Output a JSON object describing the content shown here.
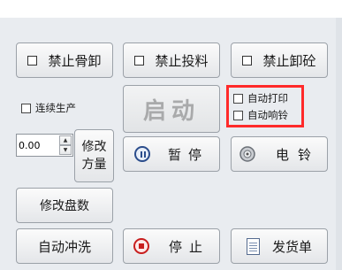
{
  "top_buttons": {
    "forbid_bone_unload": "禁止骨卸",
    "forbid_feed": "禁止投料",
    "forbid_concrete_unload": "禁止卸砼"
  },
  "continuous_production": {
    "label": "连续生产",
    "checked": false
  },
  "start_button": "启动",
  "auto_print": {
    "label": "自动打印",
    "checked": false
  },
  "auto_ring": {
    "label": "自动响铃",
    "checked": false
  },
  "quantity": {
    "value": "0.00"
  },
  "modify_quantity_button": [
    "修改",
    "方量"
  ],
  "pause_button": "暂停",
  "bell_button": "电铃",
  "modify_tray_count_button": "修改盘数",
  "auto_flush_button": "自动冲洗",
  "stop_button": "停止",
  "delivery_note_button": "发货单",
  "icons": {
    "pause": "pause-icon",
    "bell": "bell-icon",
    "stop": "stop-icon",
    "document": "document-icon"
  }
}
